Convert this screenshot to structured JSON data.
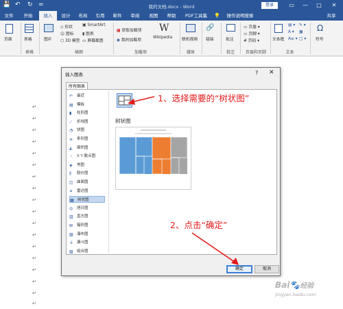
{
  "titlebar": {
    "doc_title": "我的文档.docx - Word",
    "login": "登录",
    "quick_access": [
      "💾",
      "↶",
      "↻",
      "="
    ],
    "win_controls": [
      "▭",
      "—",
      "□",
      "✕"
    ]
  },
  "tabs": [
    "文件",
    "开始",
    "插入",
    "设计",
    "布局",
    "引用",
    "邮件",
    "审阅",
    "视图",
    "帮助",
    "PDF工具集",
    "操作说明搜索",
    "共享"
  ],
  "ribbon": {
    "items": {
      "page": "页面",
      "table": "表格",
      "picture": "图片",
      "shapes": "形状",
      "icons": "图标",
      "model3d": "3D 模型",
      "smartart": "SmartArt",
      "chart": "图表",
      "screenshot": "屏幕截图",
      "get_addins": "获取加载项",
      "my_addins": "我的加载项",
      "wikipedia": "Wikipedia",
      "online_video": "联机视频",
      "link": "链接",
      "comment": "批注",
      "header": "页眉",
      "footer": "页脚",
      "page_number": "页码",
      "textbox": "文本框",
      "symbol": "符号"
    },
    "groups": [
      "表格",
      "插图",
      "加载项",
      "媒体",
      "批注",
      "页眉和页脚",
      "文本"
    ]
  },
  "paragraph_mark": "↵",
  "dialog": {
    "title": "插入图表",
    "help": "?",
    "close": "✕",
    "tab": "所有图表",
    "categories": [
      {
        "icon": "↶",
        "label": "最近"
      },
      {
        "icon": "▤",
        "label": "模板"
      },
      {
        "icon": "▮",
        "label": "柱形图"
      },
      {
        "icon": "⟋",
        "label": "折线图"
      },
      {
        "icon": "◔",
        "label": "饼图"
      },
      {
        "icon": "≡",
        "label": "条形图"
      },
      {
        "icon": "◭",
        "label": "面积图"
      },
      {
        "icon": "⁘",
        "label": "X Y 散点图"
      },
      {
        "icon": "◈",
        "label": "地图"
      },
      {
        "icon": "⫼",
        "label": "股价图"
      },
      {
        "icon": "◫",
        "label": "曲面图"
      },
      {
        "icon": "✶",
        "label": "雷达图"
      },
      {
        "icon": "▦",
        "label": "树状图"
      },
      {
        "icon": "◎",
        "label": "旭日图"
      },
      {
        "icon": "▥",
        "label": "直方图"
      },
      {
        "icon": "⊞",
        "label": "箱形图"
      },
      {
        "icon": "▨",
        "label": "瀑布图"
      },
      {
        "icon": "⏚",
        "label": "漏斗图"
      },
      {
        "icon": "▧",
        "label": "组合图"
      }
    ],
    "selected_index": 12,
    "subtype_title": "树状图",
    "ok": "确定",
    "cancel": "取消"
  },
  "annotations": {
    "step1": "1、选择需要的“树状图”",
    "step2": "2、点击“确定”"
  },
  "watermark": {
    "line1": "Bai",
    "line2": "经验",
    "url": "jingyan.baidu.com"
  },
  "colors": {
    "word_blue": "#2b579a",
    "annotation_red": "#e31b1b",
    "tm_blue": "#5b9bd5",
    "tm_orange": "#ed7d31",
    "tm_gray": "#a5a5a5"
  }
}
